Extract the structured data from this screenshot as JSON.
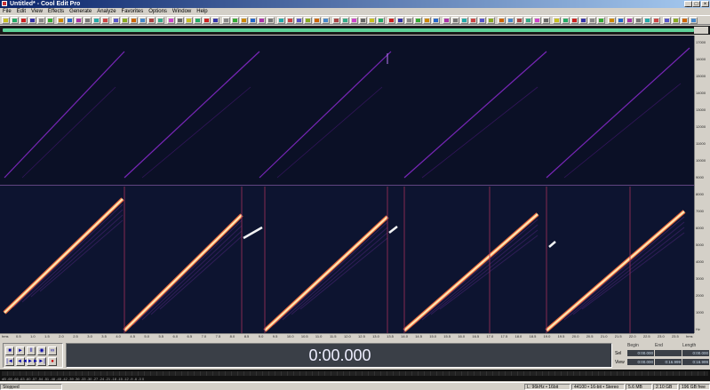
{
  "window": {
    "title": "Untitled* - Cool Edit Pro",
    "min_glyph": "_",
    "max_glyph": "□",
    "close_glyph": "×"
  },
  "menu": [
    "File",
    "Edit",
    "View",
    "Effects",
    "Generate",
    "Analyze",
    "Favorites",
    "Options",
    "Window",
    "Help"
  ],
  "toolbar_icon_colors": [
    "#c8c020",
    "#2a6",
    "#c22",
    "#33a",
    "#888",
    "#3a3",
    "#c80",
    "#26c",
    "#a3a",
    "#777",
    "#2aa",
    "#c44",
    "#55c",
    "#8a2",
    "#c60",
    "#48c",
    "#a44",
    "#3a8",
    "#c4c",
    "#666"
  ],
  "vertical_ruler": [
    "17000",
    "16000",
    "15000",
    "14000",
    "13000",
    "12000",
    "11000",
    "10000",
    "9000",
    "8000",
    "7000",
    "6000",
    "5000",
    "4000",
    "3000",
    "2000",
    "1000",
    "Hz"
  ],
  "horizontal_ruler": [
    "hms",
    "0.5",
    "1.0",
    "1.5",
    "2.0",
    "2.5",
    "3.0",
    "3.5",
    "4.0",
    "4.5",
    "5.0",
    "5.5",
    "6.0",
    "6.5",
    "7.0",
    "7.5",
    "8.0",
    "8.5",
    "9.0",
    "9.5",
    "10.0",
    "10.5",
    "11.0",
    "11.5",
    "12.0",
    "12.5",
    "13.0",
    "13.5",
    "14.0",
    "14.5",
    "15.0",
    "15.5",
    "16.0",
    "16.5",
    "17.0",
    "17.5",
    "18.0",
    "18.5",
    "19.0",
    "19.5",
    "20.0",
    "20.5",
    "21.0",
    "21.5",
    "22.0",
    "22.5",
    "23.0",
    "23.5",
    "hms"
  ],
  "transport": {
    "row1": [
      "■",
      "►",
      "II",
      "◉",
      "∞"
    ],
    "row2": [
      "|◄",
      "◄◄",
      "►►",
      "►|",
      "●"
    ]
  },
  "time_display": "0:00.000",
  "selection": {
    "headers": [
      "Begin",
      "End",
      "Length"
    ],
    "rows": [
      {
        "label": "Sel",
        "values": [
          "0:00.000",
          "",
          "0:00.000"
        ]
      },
      {
        "label": "View",
        "values": [
          "0:00.000",
          "0:16.999",
          "0:16.999"
        ]
      }
    ]
  },
  "level_scale": "dB  -69 -66 -63 -60 -57 -54 -51 -48 -45 -42 -39 -36 -33 -30 -27 -24 -21 -18 -15 -12 -9 -6 -3 0",
  "status": {
    "state": "Stopped",
    "items": [
      "L: 96kHz • 16bit",
      "44100 • 16-bit • Stereo",
      "5.6 MB",
      "2.10 GB",
      "196 GB free"
    ]
  }
}
